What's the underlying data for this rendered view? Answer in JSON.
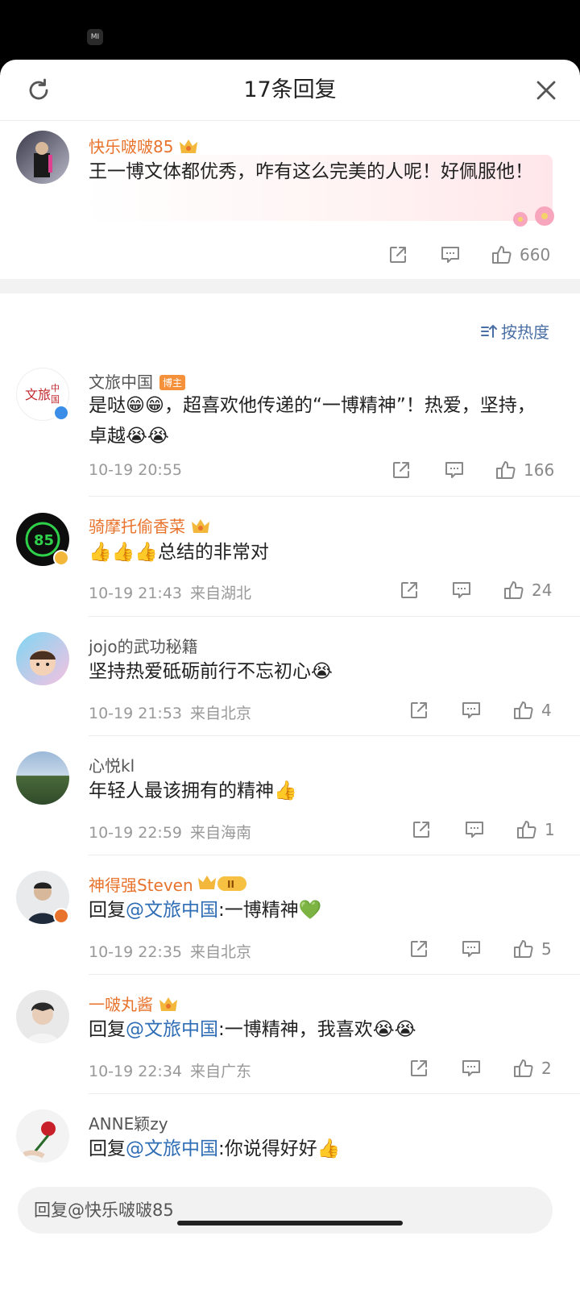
{
  "status": {
    "mi_icon": "MI"
  },
  "header": {
    "title": "17条回复",
    "refresh_icon": "refresh-icon",
    "close_icon": "close-icon"
  },
  "main_comment": {
    "user": "快乐啵啵85",
    "text": "王一博文体都优秀，咋有这么完美的人呢！好佩服他！",
    "likes": "660"
  },
  "sort": {
    "label": "按热度"
  },
  "replies": [
    {
      "user": "文旅中国",
      "badge": "博主",
      "text": "是哒😁😁，超喜欢他传递的“一博精神”！热爱，坚持，卓越😭😭",
      "time": "10-19 20:55",
      "location": "",
      "likes": "166",
      "vip": false
    },
    {
      "user": "骑摩托偷香菜",
      "text": "👍👍👍总结的非常对",
      "time": "10-19 21:43",
      "location": "来自湖北",
      "likes": "24",
      "vip": true
    },
    {
      "user": "jojo的武功秘籍",
      "text": "坚持热爱砥砺前行不忘初心😭",
      "time": "10-19 21:53",
      "location": "来自北京",
      "likes": "4",
      "vip": false
    },
    {
      "user": "心悦kl",
      "text": "年轻人最该拥有的精神👍",
      "time": "10-19 22:59",
      "location": "来自海南",
      "likes": "1",
      "vip": false
    },
    {
      "user": "神得强Steven",
      "text_prefix": "回复",
      "at": "@文旅中国",
      "text_suffix": ":一博精神💚",
      "time": "10-19 22:35",
      "location": "来自北京",
      "likes": "5",
      "vip": true
    },
    {
      "user": "一啵丸酱",
      "text_prefix": "回复",
      "at": "@文旅中国",
      "text_suffix": ":一博精神，我喜欢😭😭",
      "time": "10-19 22:34",
      "location": "来自广东",
      "likes": "2",
      "vip": true
    },
    {
      "user": "ANNE颖zy",
      "text_prefix": "回复",
      "at": "@文旅中国",
      "text_suffix": ":你说得好好👍",
      "vip": false
    }
  ],
  "reply_bar": {
    "placeholder": "回复@快乐啵啵85"
  },
  "colors": {
    "vip_name": "#e8732c",
    "link": "#2f6db5",
    "meta": "#999999"
  }
}
